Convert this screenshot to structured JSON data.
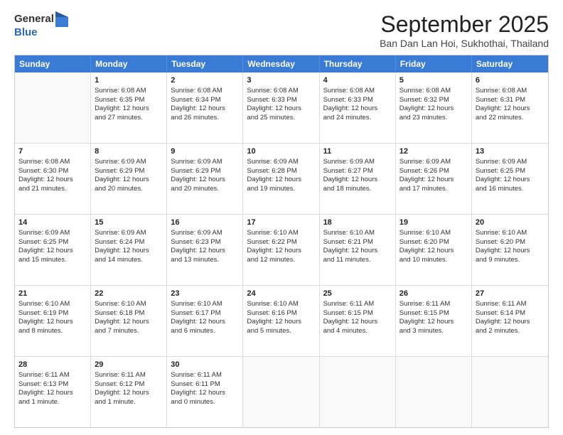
{
  "header": {
    "logo_general": "General",
    "logo_blue": "Blue",
    "month_title": "September 2025",
    "subtitle": "Ban Dan Lan Hoi, Sukhothai, Thailand"
  },
  "days_of_week": [
    "Sunday",
    "Monday",
    "Tuesday",
    "Wednesday",
    "Thursday",
    "Friday",
    "Saturday"
  ],
  "weeks": [
    [
      {
        "day": "",
        "lines": []
      },
      {
        "day": "1",
        "lines": [
          "Sunrise: 6:08 AM",
          "Sunset: 6:35 PM",
          "Daylight: 12 hours",
          "and 27 minutes."
        ]
      },
      {
        "day": "2",
        "lines": [
          "Sunrise: 6:08 AM",
          "Sunset: 6:34 PM",
          "Daylight: 12 hours",
          "and 26 minutes."
        ]
      },
      {
        "day": "3",
        "lines": [
          "Sunrise: 6:08 AM",
          "Sunset: 6:33 PM",
          "Daylight: 12 hours",
          "and 25 minutes."
        ]
      },
      {
        "day": "4",
        "lines": [
          "Sunrise: 6:08 AM",
          "Sunset: 6:33 PM",
          "Daylight: 12 hours",
          "and 24 minutes."
        ]
      },
      {
        "day": "5",
        "lines": [
          "Sunrise: 6:08 AM",
          "Sunset: 6:32 PM",
          "Daylight: 12 hours",
          "and 23 minutes."
        ]
      },
      {
        "day": "6",
        "lines": [
          "Sunrise: 6:08 AM",
          "Sunset: 6:31 PM",
          "Daylight: 12 hours",
          "and 22 minutes."
        ]
      }
    ],
    [
      {
        "day": "7",
        "lines": [
          "Sunrise: 6:08 AM",
          "Sunset: 6:30 PM",
          "Daylight: 12 hours",
          "and 21 minutes."
        ]
      },
      {
        "day": "8",
        "lines": [
          "Sunrise: 6:09 AM",
          "Sunset: 6:29 PM",
          "Daylight: 12 hours",
          "and 20 minutes."
        ]
      },
      {
        "day": "9",
        "lines": [
          "Sunrise: 6:09 AM",
          "Sunset: 6:29 PM",
          "Daylight: 12 hours",
          "and 20 minutes."
        ]
      },
      {
        "day": "10",
        "lines": [
          "Sunrise: 6:09 AM",
          "Sunset: 6:28 PM",
          "Daylight: 12 hours",
          "and 19 minutes."
        ]
      },
      {
        "day": "11",
        "lines": [
          "Sunrise: 6:09 AM",
          "Sunset: 6:27 PM",
          "Daylight: 12 hours",
          "and 18 minutes."
        ]
      },
      {
        "day": "12",
        "lines": [
          "Sunrise: 6:09 AM",
          "Sunset: 6:26 PM",
          "Daylight: 12 hours",
          "and 17 minutes."
        ]
      },
      {
        "day": "13",
        "lines": [
          "Sunrise: 6:09 AM",
          "Sunset: 6:25 PM",
          "Daylight: 12 hours",
          "and 16 minutes."
        ]
      }
    ],
    [
      {
        "day": "14",
        "lines": [
          "Sunrise: 6:09 AM",
          "Sunset: 6:25 PM",
          "Daylight: 12 hours",
          "and 15 minutes."
        ]
      },
      {
        "day": "15",
        "lines": [
          "Sunrise: 6:09 AM",
          "Sunset: 6:24 PM",
          "Daylight: 12 hours",
          "and 14 minutes."
        ]
      },
      {
        "day": "16",
        "lines": [
          "Sunrise: 6:09 AM",
          "Sunset: 6:23 PM",
          "Daylight: 12 hours",
          "and 13 minutes."
        ]
      },
      {
        "day": "17",
        "lines": [
          "Sunrise: 6:10 AM",
          "Sunset: 6:22 PM",
          "Daylight: 12 hours",
          "and 12 minutes."
        ]
      },
      {
        "day": "18",
        "lines": [
          "Sunrise: 6:10 AM",
          "Sunset: 6:21 PM",
          "Daylight: 12 hours",
          "and 11 minutes."
        ]
      },
      {
        "day": "19",
        "lines": [
          "Sunrise: 6:10 AM",
          "Sunset: 6:20 PM",
          "Daylight: 12 hours",
          "and 10 minutes."
        ]
      },
      {
        "day": "20",
        "lines": [
          "Sunrise: 6:10 AM",
          "Sunset: 6:20 PM",
          "Daylight: 12 hours",
          "and 9 minutes."
        ]
      }
    ],
    [
      {
        "day": "21",
        "lines": [
          "Sunrise: 6:10 AM",
          "Sunset: 6:19 PM",
          "Daylight: 12 hours",
          "and 8 minutes."
        ]
      },
      {
        "day": "22",
        "lines": [
          "Sunrise: 6:10 AM",
          "Sunset: 6:18 PM",
          "Daylight: 12 hours",
          "and 7 minutes."
        ]
      },
      {
        "day": "23",
        "lines": [
          "Sunrise: 6:10 AM",
          "Sunset: 6:17 PM",
          "Daylight: 12 hours",
          "and 6 minutes."
        ]
      },
      {
        "day": "24",
        "lines": [
          "Sunrise: 6:10 AM",
          "Sunset: 6:16 PM",
          "Daylight: 12 hours",
          "and 5 minutes."
        ]
      },
      {
        "day": "25",
        "lines": [
          "Sunrise: 6:11 AM",
          "Sunset: 6:15 PM",
          "Daylight: 12 hours",
          "and 4 minutes."
        ]
      },
      {
        "day": "26",
        "lines": [
          "Sunrise: 6:11 AM",
          "Sunset: 6:15 PM",
          "Daylight: 12 hours",
          "and 3 minutes."
        ]
      },
      {
        "day": "27",
        "lines": [
          "Sunrise: 6:11 AM",
          "Sunset: 6:14 PM",
          "Daylight: 12 hours",
          "and 2 minutes."
        ]
      }
    ],
    [
      {
        "day": "28",
        "lines": [
          "Sunrise: 6:11 AM",
          "Sunset: 6:13 PM",
          "Daylight: 12 hours",
          "and 1 minute."
        ]
      },
      {
        "day": "29",
        "lines": [
          "Sunrise: 6:11 AM",
          "Sunset: 6:12 PM",
          "Daylight: 12 hours",
          "and 1 minute."
        ]
      },
      {
        "day": "30",
        "lines": [
          "Sunrise: 6:11 AM",
          "Sunset: 6:11 PM",
          "Daylight: 12 hours",
          "and 0 minutes."
        ]
      },
      {
        "day": "",
        "lines": []
      },
      {
        "day": "",
        "lines": []
      },
      {
        "day": "",
        "lines": []
      },
      {
        "day": "",
        "lines": []
      }
    ]
  ]
}
